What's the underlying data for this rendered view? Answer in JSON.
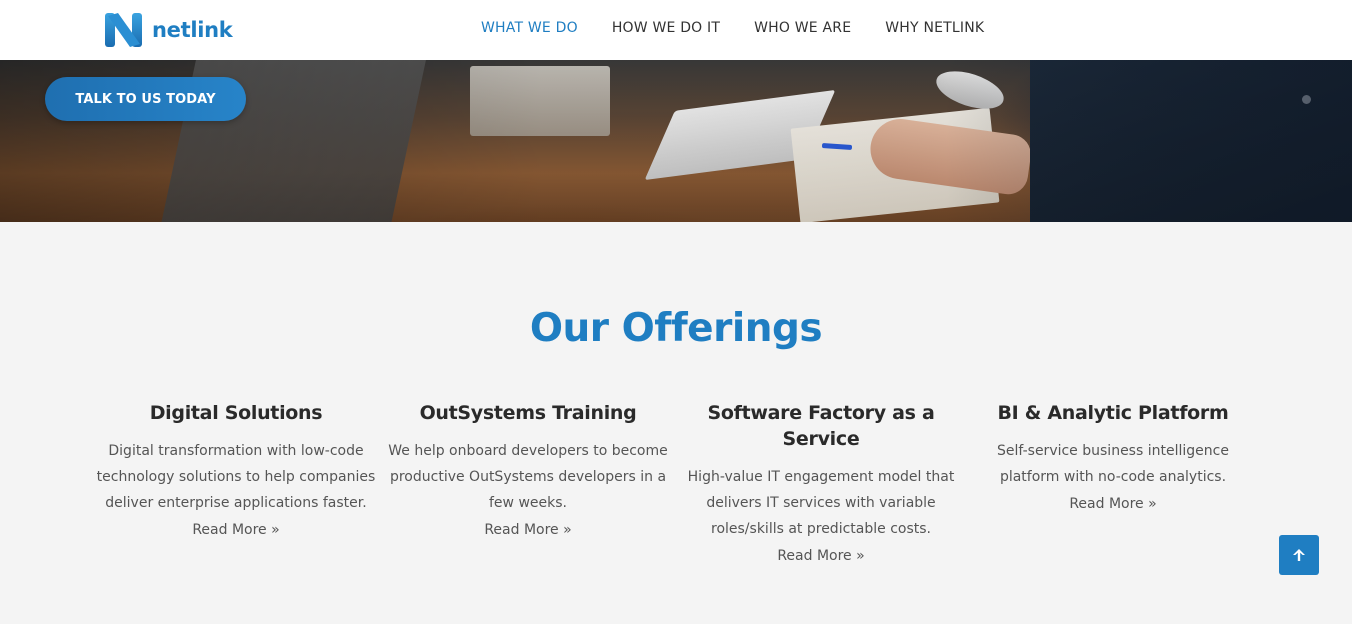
{
  "brand": {
    "name": "netlink",
    "accent": "#1f7ec2"
  },
  "nav": {
    "items": [
      {
        "label": "WHAT WE DO",
        "active": true
      },
      {
        "label": "HOW WE DO IT",
        "active": false
      },
      {
        "label": "WHO WE ARE",
        "active": false
      },
      {
        "label": "WHY NETLINK",
        "active": false
      }
    ]
  },
  "hero": {
    "cta_label": "TALK TO US TODAY"
  },
  "offerings": {
    "title": "Our Offerings",
    "cards": [
      {
        "title": "Digital Solutions",
        "desc": "Digital transformation with low-code technology solutions to help companies deliver enterprise applications faster.",
        "link": "Read More »"
      },
      {
        "title": "OutSystems Training",
        "desc": "We help onboard developers to become productive OutSystems developers in a few weeks.",
        "link": "Read More »"
      },
      {
        "title": "Software Factory as a Service",
        "desc": "High-value IT engagement model that delivers IT services with variable roles/skills at predictable costs.",
        "link": "Read More »"
      },
      {
        "title": "BI & Analytic Platform",
        "desc": "Self-service business intelligence platform with no-code analytics.",
        "link": "Read More »"
      }
    ]
  },
  "icons": {
    "scroll_top": "arrow-up-icon",
    "logo": "netlink-logo-icon"
  }
}
